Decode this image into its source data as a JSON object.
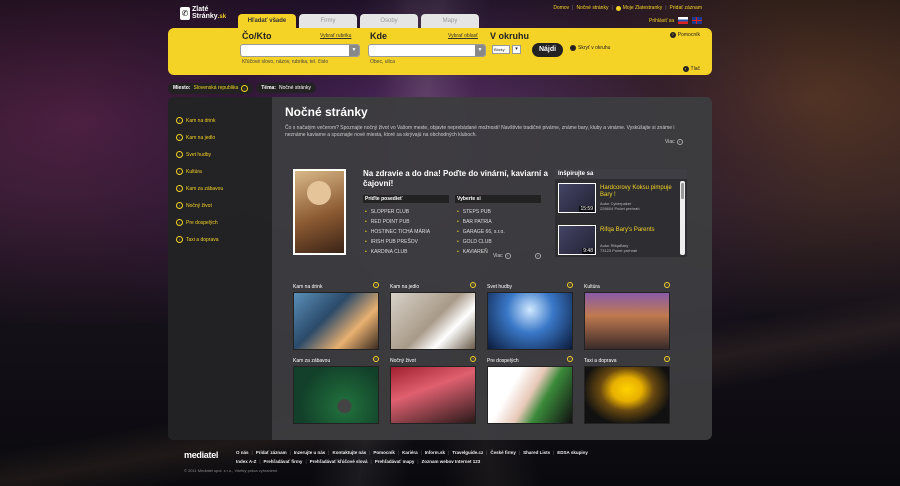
{
  "header": {
    "logo": {
      "line1": "Zlaté",
      "line2": "Stránky",
      "suffix": ".sk"
    },
    "toplinks": [
      "Domov",
      "Nočné stránky",
      "Moje Zlatestranky",
      "Pridať záznam"
    ],
    "login": "Prihlásiť sa",
    "tabs": [
      "Hľadať všade",
      "Firmy",
      "Osoby",
      "Mapy"
    ]
  },
  "search": {
    "co_label": "Čo/Kto",
    "co_link": "Vybrať rubriku",
    "co_hint": "Kľúčové slovo, názov, rubrika, tel. číslo",
    "kde_label": "Kde",
    "kde_link": "Vybrať oblasť",
    "kde_hint": "Obec, ulica",
    "okruh_label": "V okruhu",
    "okruh_value": "Blízky",
    "submit": "Nájdi",
    "map_checkbox": "Skryť v okruhu",
    "help": "Pomocník",
    "print": "Tlač"
  },
  "crumb": {
    "miesto_label": "Miesto:",
    "miesto_value": "Slovenská republika",
    "tema_label": "Téma:",
    "tema_value": "Nočné stránky"
  },
  "sidebar": {
    "items": [
      "Kam na drink",
      "Kam na jedlo",
      "Svet hudby",
      "Kultúra",
      "Kam za zábavou",
      "Nočný život",
      "Pre dospelých",
      "Taxi a doprava"
    ]
  },
  "main": {
    "title": "Nočné stránky",
    "intro": "Čo s načatým večerom? Spoznajte nočný život vo Vašom meste, objavte neprebádané možnosti! Navštívte tradičné pivárne, známe bary, kluby a vinárne. Vyskúšajte si známe i neznáme kaviarne a spoznajte nové miesta, ktoré sa skrývajú na obchodných kluboch.",
    "more": "Viac",
    "feature": {
      "title": "Na zdravie a do dna! Poďte do vinární, kaviarní a čajovní!",
      "col1_head": "Príďte posedieť",
      "col2_head": "Vyberte si",
      "col1": [
        "SLOPPER CLUB",
        "RED POINT PUB",
        "HOSTINEC TICHÁ MÁRIA",
        "IRISH PUB PREŠOV",
        "KARDINA CLUB"
      ],
      "col2": [
        "STEPS PUB",
        "BAR PATRIA",
        "GARAGE 66, s.r.o.",
        "GOLD CLUB",
        "KAVIAREŇ"
      ],
      "more": "Viac"
    },
    "inspire": {
      "title": "Inšpirujte sa",
      "videos": [
        {
          "title": "Hardcorovy Koksu pimpuje Bary !",
          "author": "Autor Cyberpaker",
          "views": "226604 Počet prehratí",
          "duration": "15:59"
        },
        {
          "title": "Rifqa Bary's Parents",
          "author": "Autor RifqaBary",
          "views": "73123 Počet prehratí",
          "duration": "9:48"
        }
      ]
    },
    "categories": [
      "Kam na drink",
      "Kam na jedlo",
      "Svet hudby",
      "Kultúra",
      "Kam za zábavou",
      "Nočný život",
      "Pre dospelých",
      "Taxi a doprava"
    ]
  },
  "footer": {
    "brand": "mediatel",
    "copyright": "© 2011 Mediatel spol. s r.o., Všetky práva vyhradené.",
    "row1": [
      "O nás",
      "Pridať záznam",
      "Inzerujte u nás",
      "Kontaktujte nás",
      "Pomocník",
      "Kariéra",
      "Inform.sk",
      "Travelguide.cz",
      "České firmy",
      "Shared Lists",
      "EDSA skupiny"
    ],
    "row2": [
      "Index A-Z",
      "Prehľadávať firmy",
      "Prehľadávať kľúčové slová",
      "Prehľadávať mapy",
      "Zoznam webov Internet 123"
    ]
  },
  "colors": {
    "accent": "#f5d226",
    "panel": "#3c3c40",
    "sidebar": "#1e1e20"
  }
}
